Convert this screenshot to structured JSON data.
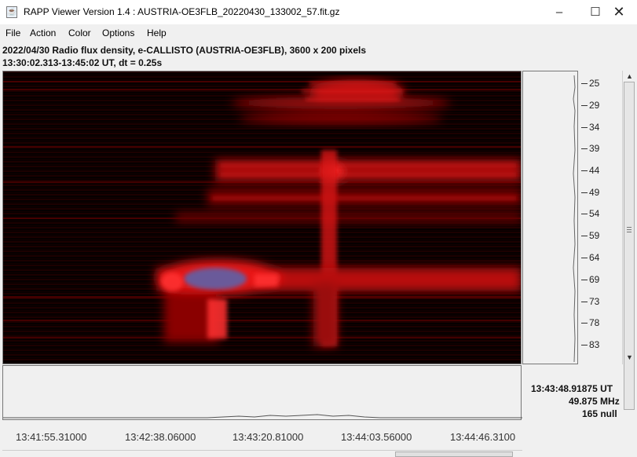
{
  "window": {
    "title": "RAPP Viewer Version 1.4 : AUSTRIA-OE3FLB_20220430_133002_57.fit.gz",
    "app_icon": "java-cup-icon",
    "controls": [
      "minimize-icon",
      "maximize-icon",
      "close-icon"
    ]
  },
  "menu": {
    "file": "File",
    "action": "Action",
    "color": "Color",
    "options": "Options",
    "help": "Help"
  },
  "info": {
    "line1": "2022/04/30  Radio flux density, e-CALLISTO (AUSTRIA-OE3FLB),  3600 x 200 pixels",
    "line2": "13:30:02.313-13:45:02 UT,  dt = 0.25s"
  },
  "frequency_axis": {
    "labels": [
      "25",
      "29",
      "34",
      "39",
      "44",
      "49",
      "54",
      "59",
      "64",
      "69",
      "73",
      "78",
      "83"
    ]
  },
  "time_axis": {
    "labels": [
      "13:41:55.31000",
      "13:42:38.06000",
      "13:43:20.81000",
      "13:44:03.56000",
      "13:44:46.3100"
    ]
  },
  "readout": {
    "time": "13:43:48.91875 UT",
    "frequency": "49.875 MHz",
    "value": "165 null"
  },
  "colors": {
    "colormap_low": "#050000",
    "colormap_high": "#ff2020",
    "burst_core": "#6a5a9a"
  }
}
